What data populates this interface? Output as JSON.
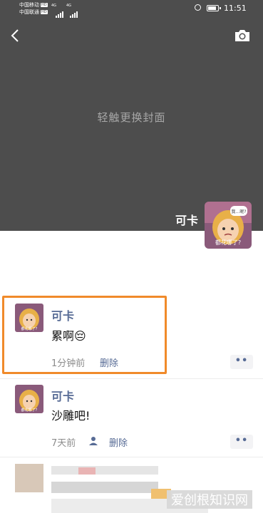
{
  "status_bar": {
    "carrier_1": "中国移动",
    "carrier_2": "中国联通",
    "hd_badge": "HD",
    "network": "4G",
    "time": "11:51"
  },
  "cover": {
    "hint": "轻触更换封面",
    "profile_name": "可卡",
    "avatar_caption_top": "我…呢?",
    "avatar_caption_bottom": "都花哪了?"
  },
  "posts": [
    {
      "user": "可卡",
      "text": "累啊",
      "emoji": "😔",
      "time": "1分钟前",
      "action": "删除",
      "avatar_caption": "都花哪了?"
    },
    {
      "user": "可卡",
      "text": "沙雕吧!",
      "time": "7天前",
      "action": "删除",
      "avatar_caption": "都花哪了?"
    }
  ],
  "more_label": "••",
  "watermark": "爱创根知识网",
  "colors": {
    "name": "#576b95",
    "highlight": "#f08a2a",
    "cover": "#4d4d4d"
  }
}
